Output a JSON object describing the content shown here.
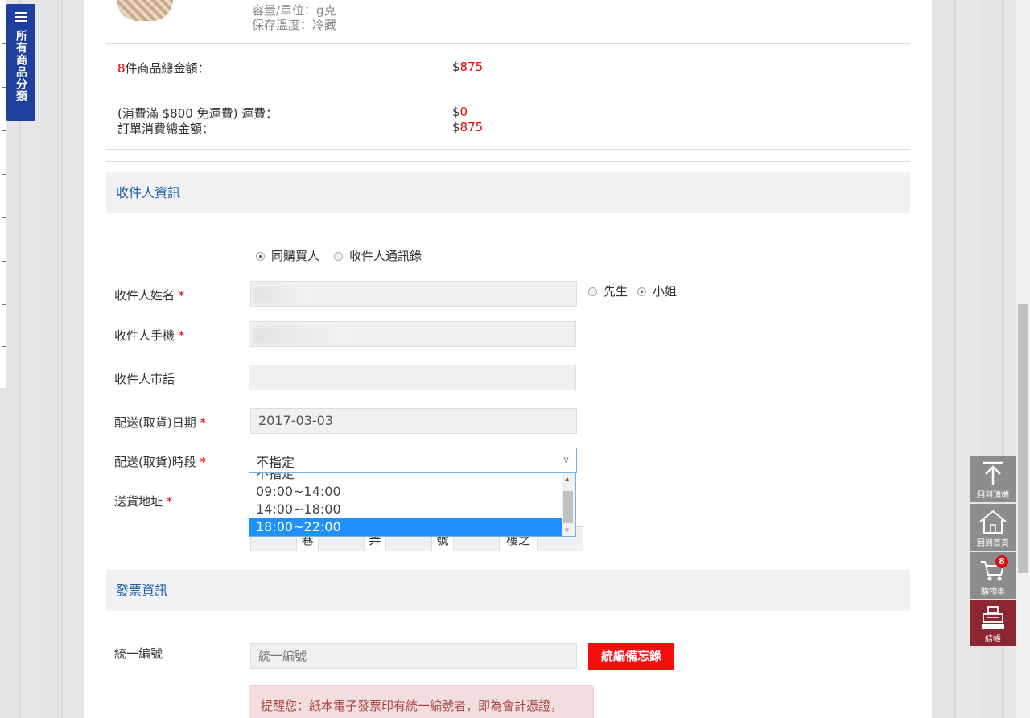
{
  "category_tab": {
    "label": "所有商品分類",
    "icon": "menu-icon"
  },
  "product": {
    "capacity": "容量/單位：g克",
    "storage": "保存溫度：冷藏"
  },
  "summary": {
    "item_count": "8",
    "item_total_label": "件商品總金額：",
    "item_total_currency": "$",
    "item_total_value": "875",
    "shipping_label": "(消費滿 $800 免運費) 運費：",
    "shipping_currency": "$",
    "shipping_value": "0",
    "order_total_label": "訂單消費總金額：",
    "order_total_currency": "$",
    "order_total_value": "875"
  },
  "recipient": {
    "section_title": "收件人資訊",
    "source_options": [
      "同購買人",
      "收件人通訊錄"
    ],
    "source_selected": "同購買人",
    "name_label": "收件人姓名",
    "title_options": [
      "先生",
      "小姐"
    ],
    "title_selected": "小姐",
    "mobile_label": "收件人手機",
    "phone_label": "收件人市話",
    "date_label": "配送(取貨)日期",
    "date_value": "2017-03-03",
    "time_label": "配送(取貨)時段",
    "time_value": "不指定",
    "time_options": [
      "不指定",
      "09:00~14:00",
      "14:00~18:00",
      "18:00~22:00"
    ],
    "time_highlighted": "18:00~22:00",
    "address_label": "送貨地址",
    "address_suffixes": [
      "巷",
      "弄",
      "號",
      "樓之"
    ],
    "required_mark": "*"
  },
  "invoice": {
    "section_title": "發票資訊",
    "tax_id_label": "統一編號",
    "tax_id_placeholder": "統一編號",
    "tax_memo_button": "統編備忘錄",
    "notice": "提醒您：紙本電子發票印有統一編號者，即為會計憑證，"
  },
  "sidebar_actions": [
    {
      "label": "回到頂端",
      "icon": "arrow-up-icon"
    },
    {
      "label": "回到首頁",
      "icon": "home-icon"
    },
    {
      "label": "購物車",
      "icon": "cart-icon",
      "badge": "8"
    },
    {
      "label": "結帳",
      "icon": "cash-register-icon"
    }
  ],
  "colors": {
    "accent_blue": "#1c5fa8",
    "price_red": "#ee0000",
    "checkout": "#8b2632",
    "tab_blue": "#1f3f9e"
  }
}
